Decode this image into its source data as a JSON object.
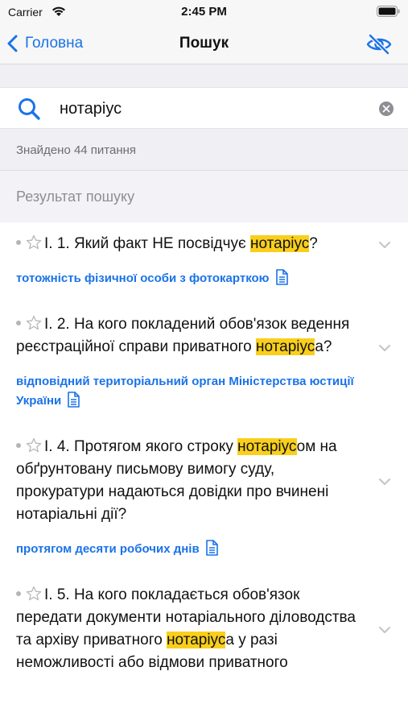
{
  "status": {
    "carrier": "Carrier",
    "time": "2:45 PM"
  },
  "nav": {
    "back_label": "Головна",
    "title": "Пошук"
  },
  "search": {
    "value": "нотаріус",
    "placeholder": ""
  },
  "found_text": "Знайдено 44 питання",
  "results_header": "Результат пошуку",
  "colors": {
    "accent": "#1a73e8",
    "highlight": "#f9cf1c"
  },
  "icons": [
    "wifi-icon",
    "battery-icon",
    "chevron-left-icon",
    "eye-slash-icon",
    "search-icon",
    "clear-icon",
    "star-outline-icon",
    "chevron-down-icon",
    "document-icon"
  ],
  "results": [
    {
      "prefix": "I. 1. Який факт НЕ посвідчує ",
      "highlight": "нотаріус",
      "suffix": "?",
      "answer": "тотожність фізичної особи з фотокарткою"
    },
    {
      "prefix": "I. 2. На кого покладений обов'язок ведення реєстраційної справи приватного ",
      "highlight": "нотаріус",
      "suffix": "а?",
      "answer": "відповідний територіальний орган Міністерства юстиції України"
    },
    {
      "prefix": "I. 4. Протягом якого строку ",
      "highlight": "нотаріус",
      "suffix": "ом на обґрунтовану письмову вимогу суду, прокуратури надаються довідки про вчинені нотаріальні дії?",
      "answer": "протягом десяти робочих днів"
    },
    {
      "prefix": "I. 5. На кого покладається обов'язок передати документи нотаріального діловодства та архіву приватного ",
      "highlight": "нотаріус",
      "suffix": "а у разі неможливості або відмови приватного",
      "answer": ""
    }
  ]
}
